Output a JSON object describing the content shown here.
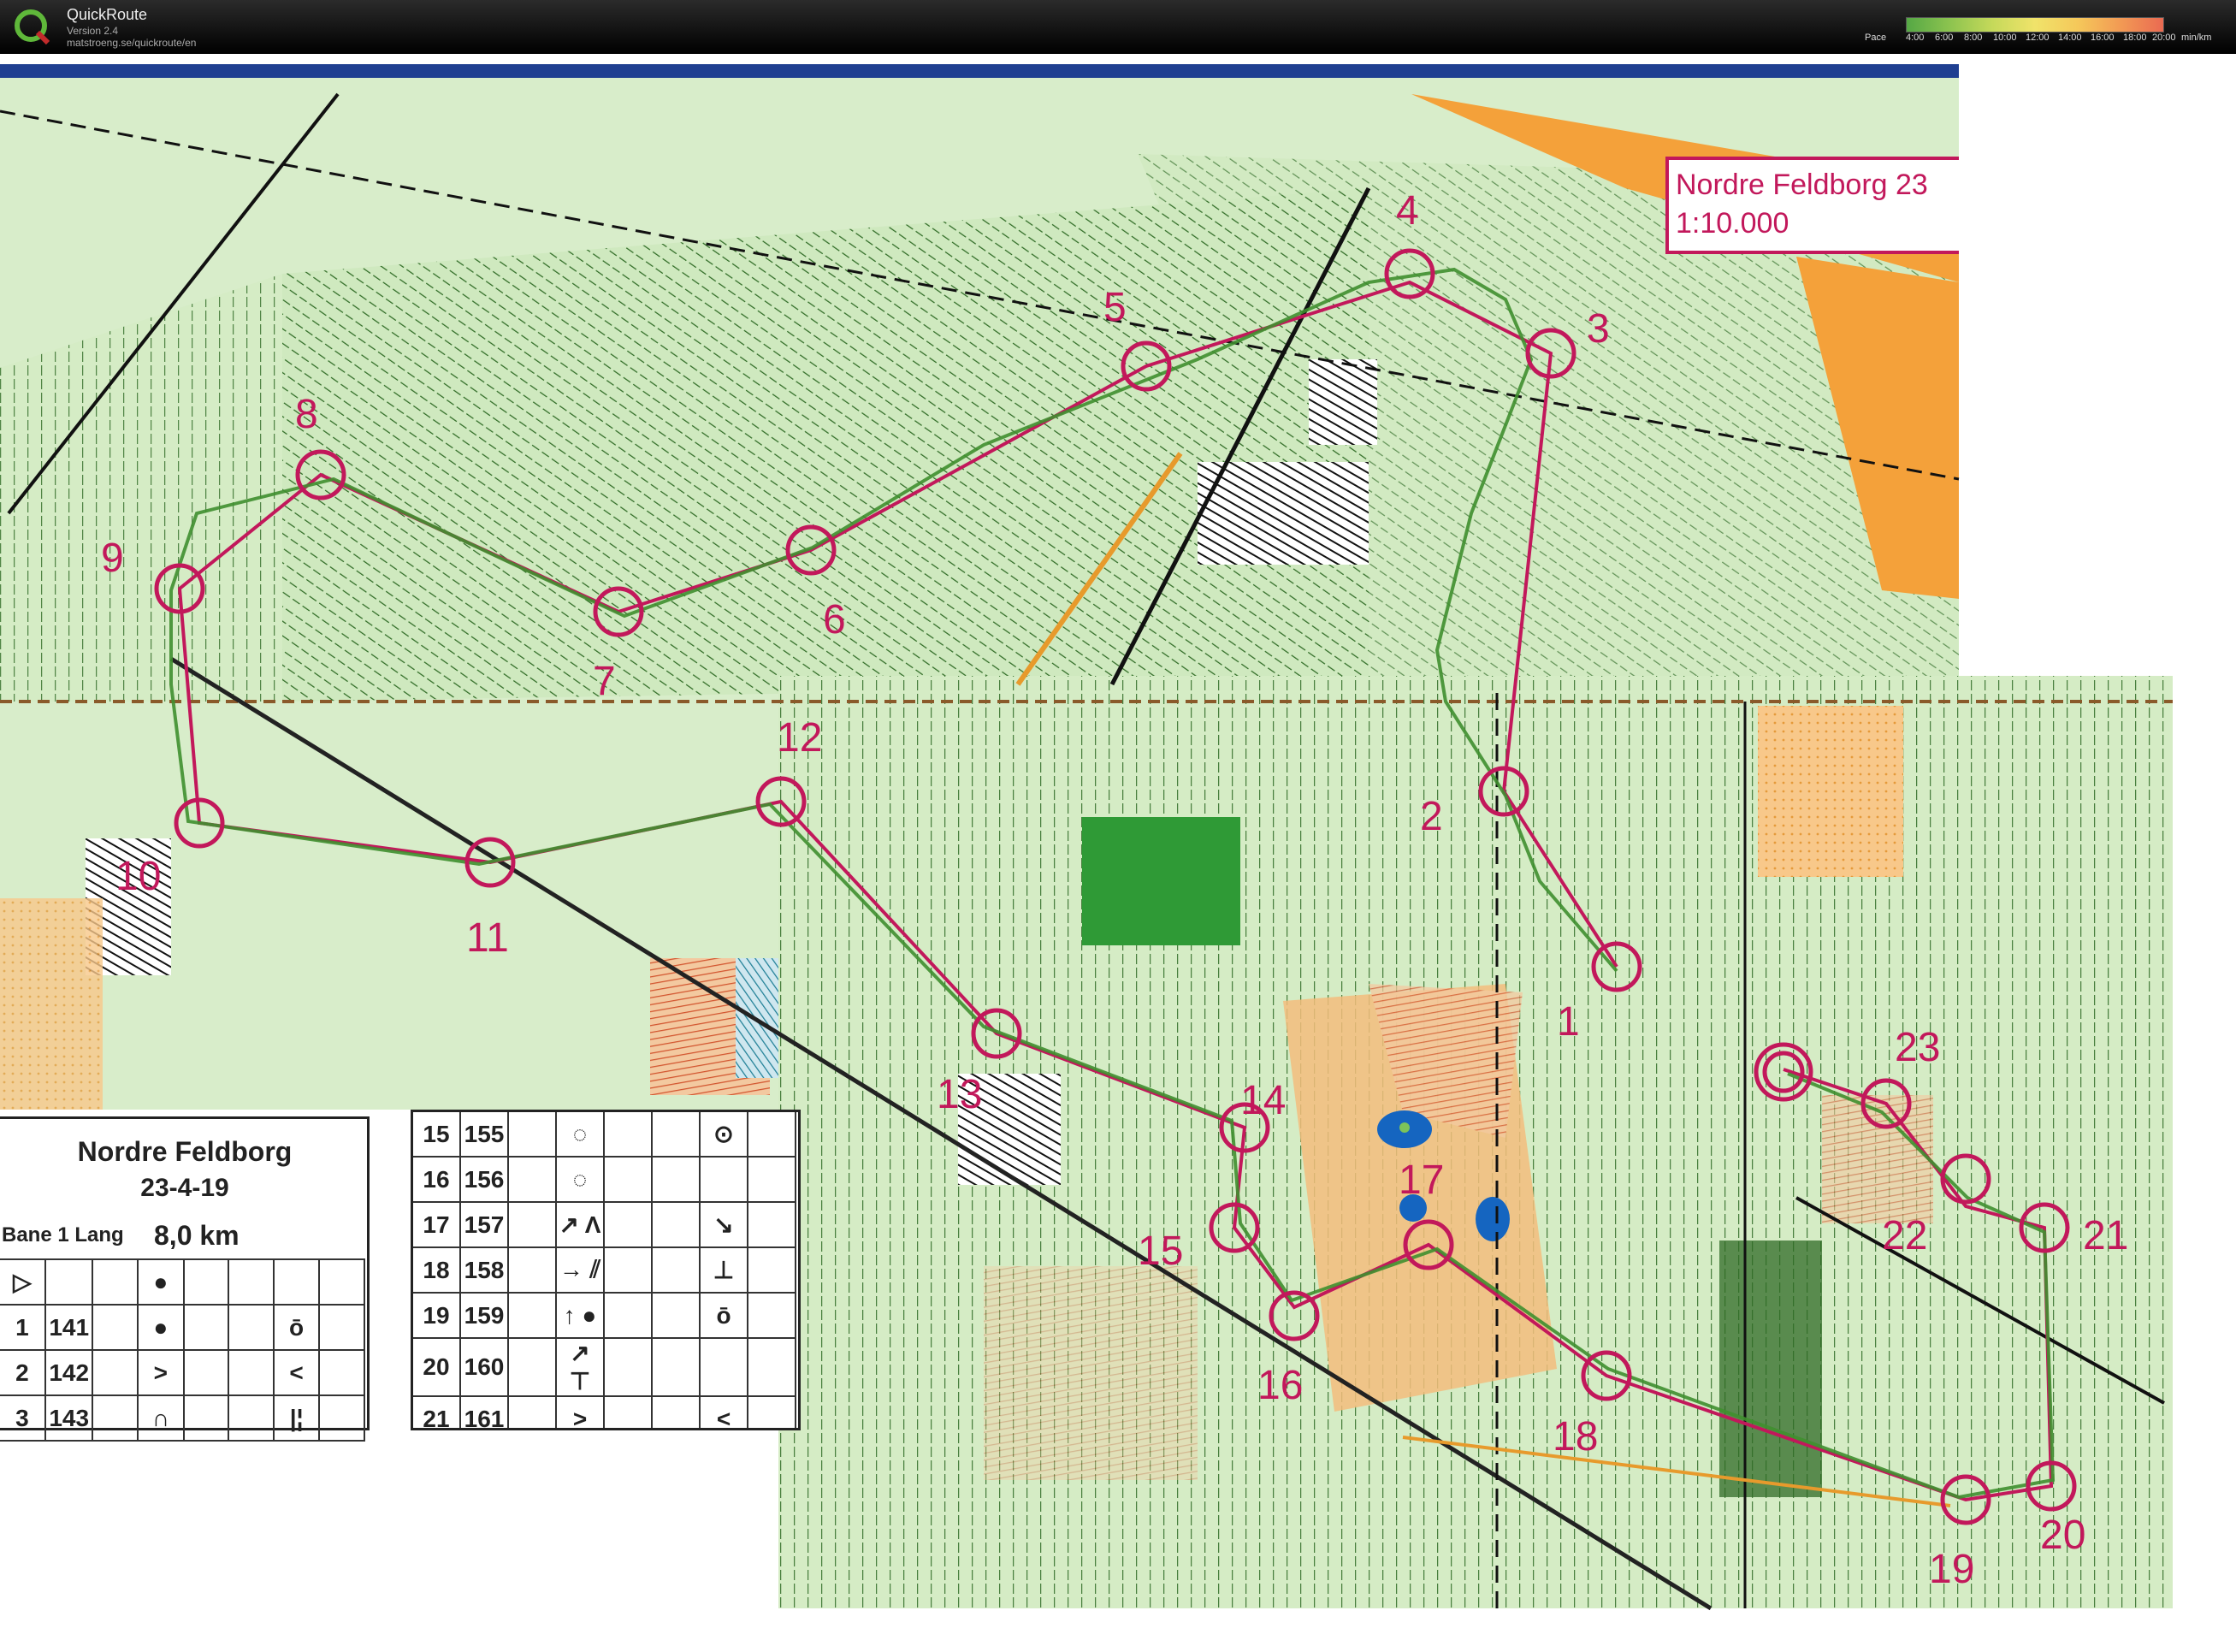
{
  "app": {
    "title": "QuickRoute",
    "version": "Version 2.4",
    "url": "matstroeng.se/quickroute/en"
  },
  "pace_legend": {
    "label": "Pace",
    "ticks": [
      "4:00",
      "6:00",
      "8:00",
      "10:00",
      "12:00",
      "14:00",
      "16:00",
      "18:00",
      "20:00"
    ],
    "unit": "min/km",
    "colors": [
      "#55a845",
      "#8cc34f",
      "#c5d95a",
      "#f0e36a",
      "#f5c85a",
      "#f29a54",
      "#ea6a52"
    ]
  },
  "map": {
    "title": "Nordre Feldborg 23",
    "scale": "1:10.000",
    "controls_upper": [
      "1",
      "2",
      "3",
      "4",
      "5",
      "6",
      "7",
      "8",
      "9",
      "10",
      "11",
      "12"
    ],
    "controls_lower": [
      "13",
      "14",
      "15",
      "16",
      "17",
      "18",
      "19",
      "20",
      "21",
      "22",
      "23"
    ],
    "colors": {
      "course": "#c2185b",
      "route": "#3f8f2f",
      "forest": "#a6d98a",
      "open": "#f7c57a",
      "water": "#1565c0"
    }
  },
  "description_card": {
    "title": "Nordre Feldborg",
    "date": "23-4-19",
    "course": "Bane 1 Lang",
    "distance": "8,0 km",
    "left_rows": [
      {
        "num": "▷",
        "code": "",
        "symbol": "●",
        "extra": ""
      },
      {
        "num": "1",
        "code": "141",
        "symbol": "●",
        "extra": "ō"
      },
      {
        "num": "2",
        "code": "142",
        "symbol": ">",
        "extra": "<"
      },
      {
        "num": "3",
        "code": "143",
        "symbol": "∩",
        "extra": "|¦"
      }
    ],
    "right_rows": [
      {
        "num": "15",
        "code": "155",
        "symbol": "◌",
        "extra": "⊙"
      },
      {
        "num": "16",
        "code": "156",
        "symbol": "◌",
        "extra": ""
      },
      {
        "num": "17",
        "code": "157",
        "symbol": "↗ Λ",
        "extra": "↘"
      },
      {
        "num": "18",
        "code": "158",
        "symbol": "→ ⫽",
        "extra": "⊥"
      },
      {
        "num": "19",
        "code": "159",
        "symbol": "↑ ●",
        "extra": "ō"
      },
      {
        "num": "20",
        "code": "160",
        "symbol": "↗ ⊤",
        "extra": ""
      },
      {
        "num": "21",
        "code": "161",
        "symbol": ">",
        "extra": "<"
      }
    ]
  }
}
